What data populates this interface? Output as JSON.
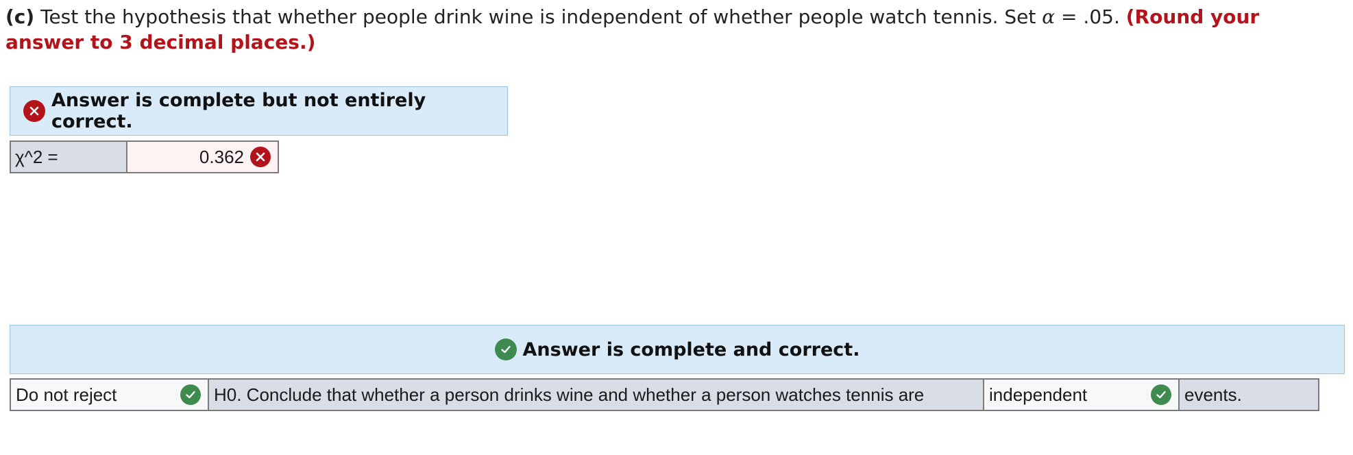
{
  "question": {
    "part": "(c)",
    "text_before_alpha": " Test the hypothesis that whether people drink wine is independent of whether people watch tennis. Set ",
    "alpha_symbol": "α",
    "text_after_alpha": " = .05. ",
    "round_note": "(Round your answer to 3 decimal places.)"
  },
  "result_banner_1": {
    "icon": "x-circle-icon",
    "text": "Answer is complete but not entirely correct."
  },
  "chi_square": {
    "label": "χ^2 =",
    "value": "0.362",
    "status_icon": "x-circle-icon"
  },
  "result_banner_2": {
    "icon": "check-circle-icon",
    "text": "Answer is complete and correct."
  },
  "conclusion": {
    "decision_value": "Do not reject",
    "decision_icon": "check-circle-icon",
    "middle_text": "H0. Conclude that whether a person drinks wine and whether a person watches tennis are",
    "relation_value": "independent",
    "relation_icon": "check-circle-icon",
    "end_text": "events."
  },
  "colors": {
    "incorrect_red": "#b3131b",
    "correct_green": "#3e8a4f",
    "banner_blue": "#d9eaf8",
    "label_gray": "#d9dde6"
  }
}
